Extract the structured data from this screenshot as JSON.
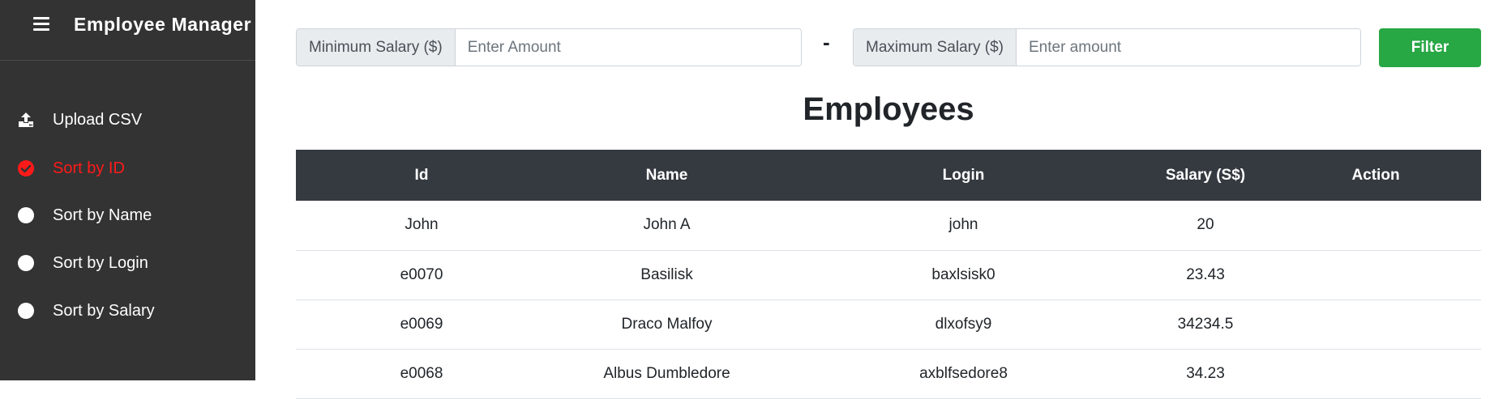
{
  "app": {
    "title": "Employee Manager"
  },
  "sidebar": {
    "items": [
      {
        "label": "Upload CSV",
        "icon": "upload-icon"
      },
      {
        "label": "Sort by ID",
        "icon": "check-circle-icon",
        "active": true
      },
      {
        "label": "Sort by Name",
        "icon": "radio-dot-icon"
      },
      {
        "label": "Sort by Login",
        "icon": "radio-dot-icon"
      },
      {
        "label": "Sort by Salary",
        "icon": "radio-dot-icon"
      }
    ]
  },
  "filter": {
    "min_label": "Minimum Salary ($)",
    "min_placeholder": "Enter Amount",
    "separator": "-",
    "max_label": "Maximum Salary ($)",
    "max_placeholder": "Enter amount",
    "button_label": "Filter"
  },
  "main": {
    "heading": "Employees"
  },
  "table": {
    "headers": [
      "Id",
      "Name",
      "Login",
      "Salary (S$)",
      "Action"
    ],
    "rows": [
      {
        "id": "John",
        "name": "John A",
        "login": "john",
        "salary": "20",
        "action": ""
      },
      {
        "id": "e0070",
        "name": "Basilisk",
        "login": "baxlsisk0",
        "salary": "23.43",
        "action": ""
      },
      {
        "id": "e0069",
        "name": "Draco Malfoy",
        "login": "dlxofsy9",
        "salary": "34234.5",
        "action": ""
      },
      {
        "id": "e0068",
        "name": "Albus Dumbledore",
        "login": "axblfsedore8",
        "salary": "34.23",
        "action": ""
      }
    ]
  },
  "colors": {
    "sidebar_bg": "#333333",
    "active_item": "#ff1a1a",
    "filter_button": "#28a745",
    "table_header_bg": "#343a40"
  }
}
